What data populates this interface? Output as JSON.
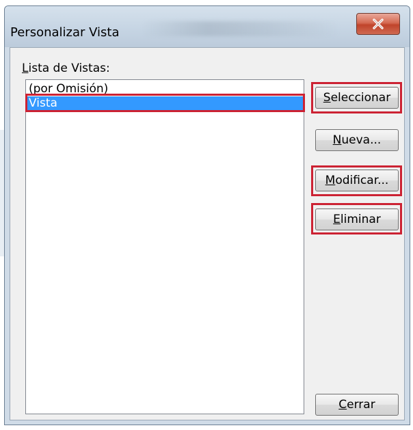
{
  "window": {
    "title": "Personalizar Vista",
    "close_icon": "close-x-icon"
  },
  "list": {
    "label": "Lista de Vistas:",
    "label_accel": "L",
    "label_rest": "ista de Vistas:",
    "items": [
      {
        "label": "(por Omisión)",
        "selected": false
      },
      {
        "label": "Vista",
        "selected": true
      }
    ]
  },
  "buttons": {
    "select": {
      "accel": "S",
      "rest": "eleccionar",
      "highlighted": true
    },
    "new": {
      "accel": "N",
      "rest": "ueva...",
      "highlighted": false
    },
    "modify": {
      "accel": "M",
      "rest": "odificar...",
      "highlighted": true
    },
    "delete": {
      "accel": "E",
      "rest": "liminar",
      "highlighted": true
    },
    "close": {
      "accel": "C",
      "rest": "errar",
      "highlighted": false
    }
  },
  "colors": {
    "selection": "#3399ff",
    "annotation_red": "#cc2233",
    "close_button": "#c0442b"
  }
}
